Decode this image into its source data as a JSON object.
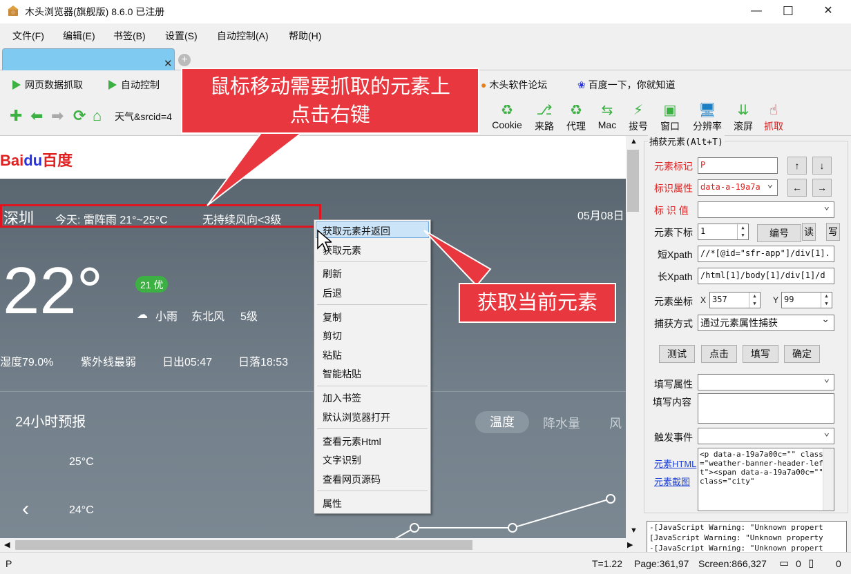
{
  "window": {
    "title": "木头浏览器(旗舰版) 8.6.0  已注册",
    "min": "—",
    "max": "☐",
    "close": "✕"
  },
  "menu": [
    "文件(F)",
    "编辑(E)",
    "书签(B)",
    "设置(S)",
    "自动控制(A)",
    "帮助(H)"
  ],
  "tab": {
    "close": "✕",
    "add": "+"
  },
  "bookmarks": {
    "b1": "网页数据抓取",
    "b2": "自动控制",
    "b3": "木头软件论坛",
    "b4": "百度一下，你就知道"
  },
  "nav": {
    "url": "天气&srcid=4"
  },
  "tools": [
    {
      "label": "Cookie"
    },
    {
      "label": "来路"
    },
    {
      "label": "代理"
    },
    {
      "label": "Mac"
    },
    {
      "label": "拔号"
    },
    {
      "label": "窗口"
    },
    {
      "label": "分辨率"
    },
    {
      "label": "滚屏"
    },
    {
      "label": "抓取"
    }
  ],
  "callouts": {
    "c1_line1": "鼠标移动需要抓取的元素上",
    "c1_line2": "点击右键",
    "c2": "获取当前元素"
  },
  "web": {
    "logo_left": "Bai",
    "logo_mid": "du",
    "logo_right": "百度",
    "city": "深圳",
    "today": "今天: 雷阵雨 21°~25°C",
    "wind": "无持续风向<3级",
    "date": "05月08日",
    "temp": "22°",
    "aqi": "21 优",
    "now": "小雨",
    "now_wind": "东北风",
    "now_level": "5级",
    "humidity": "湿度79.0%",
    "uv": "紫外线最弱",
    "sunrise": "日出05:47",
    "sunset": "日落18:53",
    "forecast_title": "24小时预报",
    "tab_temp": "温度",
    "tab_rain": "降水量",
    "tab_wind": "风",
    "y1": "25°C",
    "y2": "24°C",
    "chart_prev": "‹"
  },
  "context_menu": [
    "获取元素并返回",
    "获取元素",
    "刷新",
    "后退",
    "复制",
    "剪切",
    "粘贴",
    "智能粘贴",
    "加入书签",
    "默认浏览器打开",
    "查看元素Html",
    "文字识别",
    "查看网页源码",
    "属性"
  ],
  "panel": {
    "group_title": "捕获元素(Alt+T)",
    "l_tag": "元素标记",
    "v_tag": "P",
    "l_attr": "标识属性",
    "v_attr": "data-a-19a7a",
    "l_val": "标 识 值",
    "v_val": "",
    "l_index": "元素下标",
    "v_index": "1",
    "btn_num": "编号",
    "btn_read": "读",
    "btn_write": "写",
    "l_short": "短Xpath",
    "v_short": "//*[@id=\"sfr-app\"]/div[1].",
    "l_long": "长Xpath",
    "v_long": "/html[1]/body[1]/div[1]/d",
    "l_coord": "元素坐标",
    "x_label": "X",
    "x_val": "357",
    "y_label": "Y",
    "y_val": "99",
    "l_mode": "捕获方式",
    "v_mode": "通过元素属性捕获",
    "b_test": "测试",
    "b_click": "点击",
    "b_fill": "填写",
    "b_ok": "确定",
    "l_fill_attr": "填写属性",
    "l_fill_content": "填写内容",
    "l_event": "触发事件",
    "link_html": "元素HTML",
    "link_shot": "元素截图",
    "html": "<p data-a-19a7a00c=\"\" class=\"weather-banner-header-left\"><span data-a-19a7a00c=\"\" class=\"city\"",
    "log": [
      "-[JavaScript Warning: \"Unknown propert",
      "[JavaScript Warning: \"Unknown property",
      "-[JavaScript Warning: \"Unknown propert"
    ]
  },
  "status": {
    "left": "P",
    "timing": "T=1.22",
    "page": "Page:361,97",
    "screen": "Screen:866,327",
    "c1": "0",
    "c2": "0"
  },
  "chart_data": {
    "type": "line",
    "series": [
      {
        "name": "",
        "values": [
          24.0,
          24.0,
          24.6
        ]
      }
    ],
    "ylim": [
      24,
      25
    ],
    "y_ticks": [
      "25°C",
      "24°C"
    ]
  }
}
